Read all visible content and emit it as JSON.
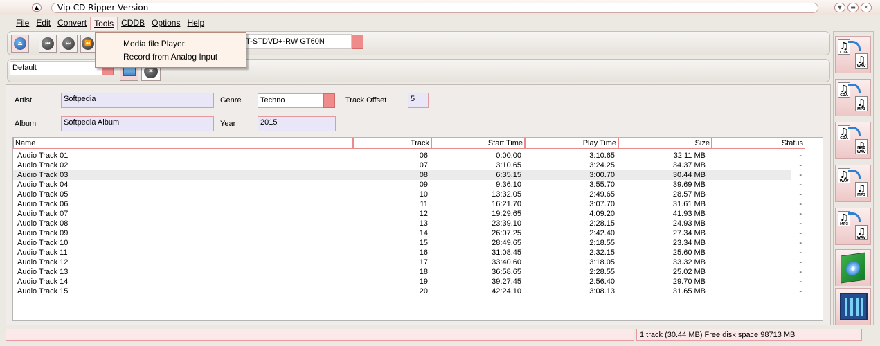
{
  "window": {
    "title": "Vip CD Ripper Version"
  },
  "menu": [
    "File",
    "Edit",
    "Convert",
    "Tools",
    "CDDB",
    "Options",
    "Help"
  ],
  "tools_menu": [
    "Media file Player",
    "Record from Analog Input"
  ],
  "drive": {
    "value": "T-STDVD+-RW GT60N"
  },
  "preset": {
    "value": "Default"
  },
  "fields": {
    "artist_label": "Artist",
    "artist": "Softpedia",
    "album_label": "Album",
    "album": "Softpedia Album",
    "genre_label": "Genre",
    "genre": "Techno",
    "year_label": "Year",
    "year": "2015",
    "offset_label": "Track Offset",
    "offset": "5"
  },
  "columns": [
    "Name",
    "Track",
    "Start Time",
    "Play Time",
    "Size",
    "Status"
  ],
  "tracks": [
    [
      "Audio Track 01",
      "06",
      "0:00.00",
      "3:10.65",
      "32.11 MB",
      "-"
    ],
    [
      "Audio Track 02",
      "07",
      "3:10.65",
      "3:24.25",
      "34.37 MB",
      "-"
    ],
    [
      "Audio Track 03",
      "08",
      "6:35.15",
      "3:00.70",
      "30.44 MB",
      "-"
    ],
    [
      "Audio Track 04",
      "09",
      "9:36.10",
      "3:55.70",
      "39.69 MB",
      "-"
    ],
    [
      "Audio Track 05",
      "10",
      "13:32.05",
      "2:49.65",
      "28.57 MB",
      "-"
    ],
    [
      "Audio Track 06",
      "11",
      "16:21.70",
      "3:07.70",
      "31.61 MB",
      "-"
    ],
    [
      "Audio Track 07",
      "12",
      "19:29.65",
      "4:09.20",
      "41.93 MB",
      "-"
    ],
    [
      "Audio Track 08",
      "13",
      "23:39.10",
      "2:28.15",
      "24.93 MB",
      "-"
    ],
    [
      "Audio Track 09",
      "14",
      "26:07.25",
      "2:42.40",
      "27.34 MB",
      "-"
    ],
    [
      "Audio Track 10",
      "15",
      "28:49.65",
      "2:18.55",
      "23.34 MB",
      "-"
    ],
    [
      "Audio Track 11",
      "16",
      "31:08.45",
      "2:32.15",
      "25.60 MB",
      "-"
    ],
    [
      "Audio Track 12",
      "17",
      "33:40.60",
      "3:18.05",
      "33.32 MB",
      "-"
    ],
    [
      "Audio Track 13",
      "18",
      "36:58.65",
      "2:28.55",
      "25.02 MB",
      "-"
    ],
    [
      "Audio Track 14",
      "19",
      "39:27.45",
      "2:56.40",
      "29.70 MB",
      "-"
    ],
    [
      "Audio Track 15",
      "20",
      "42:24.10",
      "3:08.13",
      "31.65 MB",
      "-"
    ]
  ],
  "selected_track": "Audio Track 03",
  "converters": [
    {
      "from": "CDA",
      "to": "WAV"
    },
    {
      "from": "CDA",
      "to": "MP3"
    },
    {
      "from": "CDA",
      "to": "MP3 WAV"
    },
    {
      "from": "WAV",
      "to": "MP3"
    },
    {
      "from": "MP3",
      "to": "WAV"
    }
  ],
  "status": {
    "left": "",
    "right": "1 track (30.44 MB) Free disk space 98713 MB"
  },
  "colors": {
    "accent": "#f08b8b",
    "field_border": "#e39a9f",
    "menu_bg": "#fdf3ea"
  }
}
